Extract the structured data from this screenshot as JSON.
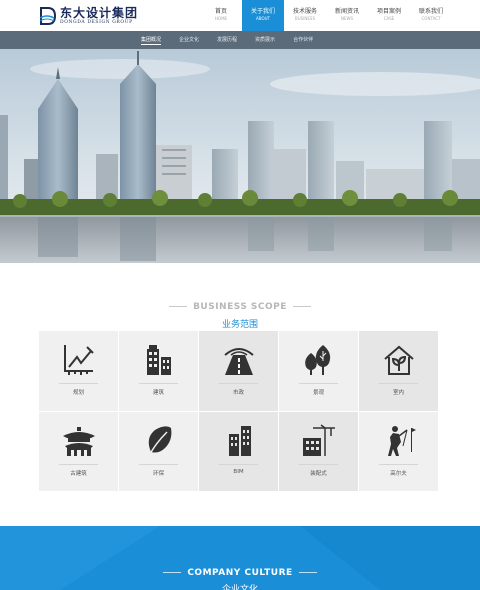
{
  "brand": {
    "name_cn": "东大设计集团",
    "name_en": "DONGDA DESIGN GROUP"
  },
  "nav": [
    {
      "cn": "首页",
      "en": "HOME",
      "active": false
    },
    {
      "cn": "关于我们",
      "en": "ABOUT",
      "active": true
    },
    {
      "cn": "技术服务",
      "en": "BUSINESS",
      "active": false
    },
    {
      "cn": "新闻资讯",
      "en": "NEWS",
      "active": false
    },
    {
      "cn": "项目案例",
      "en": "CASE",
      "active": false
    },
    {
      "cn": "联系我们",
      "en": "CONTACT",
      "active": false
    }
  ],
  "subnav": [
    "集团概况",
    "企业文化",
    "发展历程",
    "资质展示",
    "合作伙伴"
  ],
  "subnav_active_index": 0,
  "scope": {
    "title_en": "BUSINESS SCOPE",
    "title_cn": "业务范围",
    "items": [
      {
        "label": "规划",
        "icon": "planning-icon"
      },
      {
        "label": "建筑",
        "icon": "building-icon"
      },
      {
        "label": "市政",
        "icon": "road-icon"
      },
      {
        "label": "景观",
        "icon": "trees-icon"
      },
      {
        "label": "室内",
        "icon": "interior-plant-icon"
      },
      {
        "label": "古建筑",
        "icon": "pagoda-icon"
      },
      {
        "label": "环保",
        "icon": "leaf-icon"
      },
      {
        "label": "BIM",
        "icon": "bim-building-icon"
      },
      {
        "label": "装配式",
        "icon": "crane-icon"
      },
      {
        "label": "高尔夫",
        "icon": "golfer-icon"
      }
    ]
  },
  "culture": {
    "title_en": "COMPANY CULTURE",
    "title_cn": "企业文化"
  },
  "colors": {
    "accent": "#1a8fd8",
    "subnav": "#5b6b79",
    "brand_navy": "#1a2a5a"
  }
}
